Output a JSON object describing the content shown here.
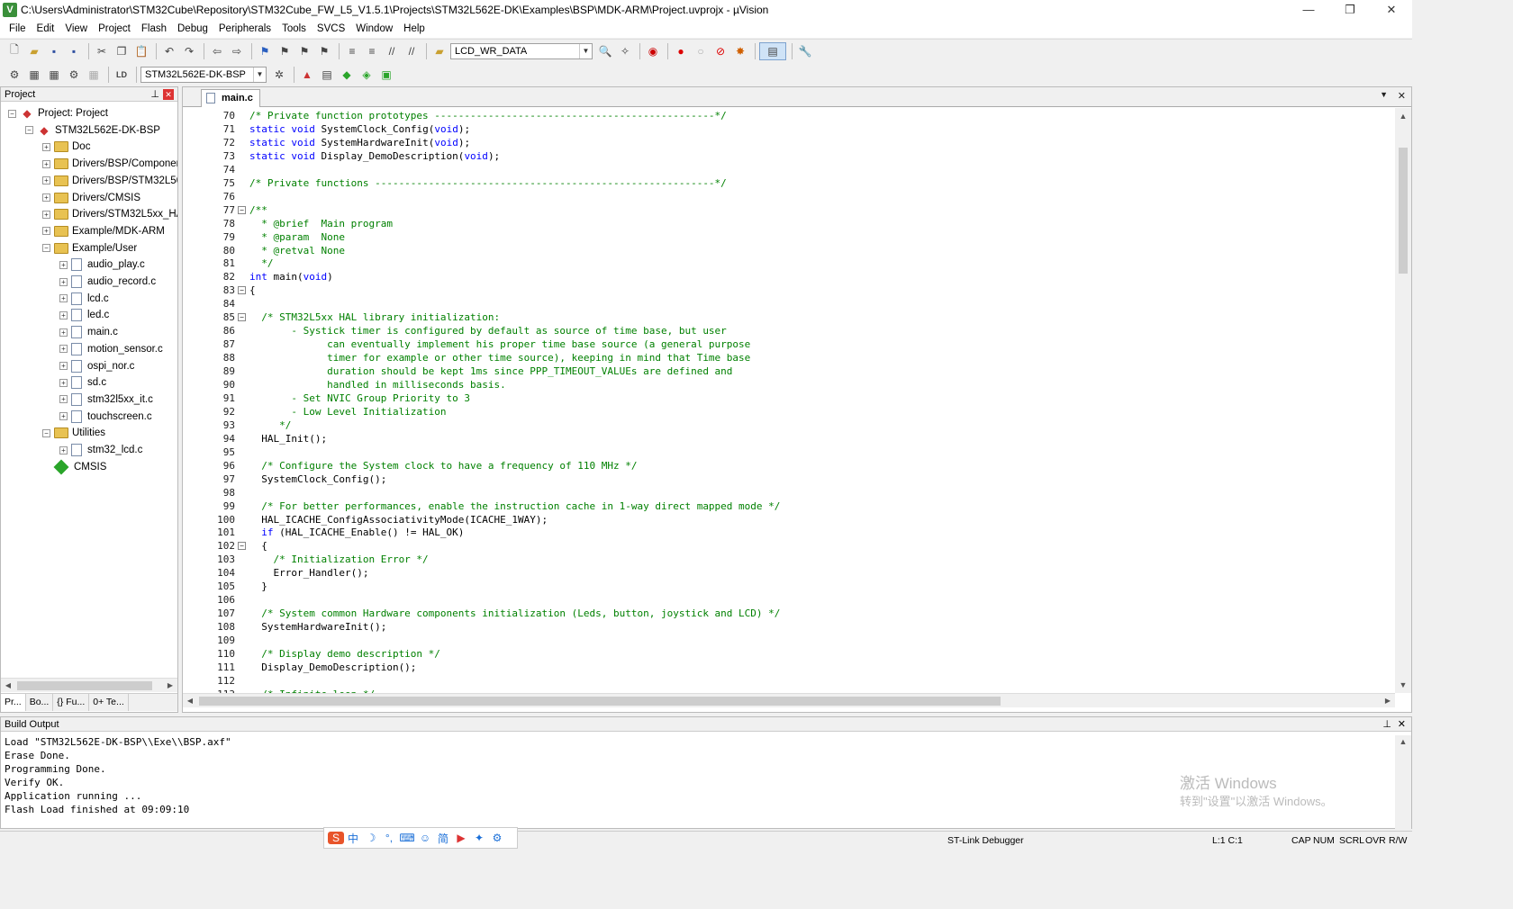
{
  "window": {
    "title": "C:\\Users\\Administrator\\STM32Cube\\Repository\\STM32Cube_FW_L5_V1.5.1\\Projects\\STM32L562E-DK\\Examples\\BSP\\MDK-ARM\\Project.uvprojx - µVision",
    "app_icon": "V"
  },
  "menu": [
    "File",
    "Edit",
    "View",
    "Project",
    "Flash",
    "Debug",
    "Peripherals",
    "Tools",
    "SVCS",
    "Window",
    "Help"
  ],
  "toolbar1": {
    "find_combo": "LCD_WR_DATA"
  },
  "toolbar2": {
    "target_combo": "STM32L562E-DK-BSP"
  },
  "project_panel": {
    "header": "Project",
    "tree": [
      {
        "label": "Project: Project",
        "level": 0,
        "kind": "project",
        "exp": "−"
      },
      {
        "label": "STM32L562E-DK-BSP",
        "level": 1,
        "kind": "target",
        "exp": "−"
      },
      {
        "label": "Doc",
        "level": 2,
        "kind": "folder",
        "exp": "+"
      },
      {
        "label": "Drivers/BSP/Componen",
        "level": 2,
        "kind": "folder",
        "exp": "+"
      },
      {
        "label": "Drivers/BSP/STM32L56",
        "level": 2,
        "kind": "folder",
        "exp": "+"
      },
      {
        "label": "Drivers/CMSIS",
        "level": 2,
        "kind": "folder",
        "exp": "+"
      },
      {
        "label": "Drivers/STM32L5xx_HA",
        "level": 2,
        "kind": "folder",
        "exp": "+"
      },
      {
        "label": "Example/MDK-ARM",
        "level": 2,
        "kind": "folder",
        "exp": "+"
      },
      {
        "label": "Example/User",
        "level": 2,
        "kind": "folder",
        "exp": "−"
      },
      {
        "label": "audio_play.c",
        "level": 3,
        "kind": "file",
        "exp": "+"
      },
      {
        "label": "audio_record.c",
        "level": 3,
        "kind": "file",
        "exp": "+"
      },
      {
        "label": "lcd.c",
        "level": 3,
        "kind": "file",
        "exp": "+"
      },
      {
        "label": "led.c",
        "level": 3,
        "kind": "file",
        "exp": "+"
      },
      {
        "label": "main.c",
        "level": 3,
        "kind": "file",
        "exp": "+"
      },
      {
        "label": "motion_sensor.c",
        "level": 3,
        "kind": "file",
        "exp": "+"
      },
      {
        "label": "ospi_nor.c",
        "level": 3,
        "kind": "file",
        "exp": "+"
      },
      {
        "label": "sd.c",
        "level": 3,
        "kind": "file",
        "exp": "+"
      },
      {
        "label": "stm32l5xx_it.c",
        "level": 3,
        "kind": "file",
        "exp": "+"
      },
      {
        "label": "touchscreen.c",
        "level": 3,
        "kind": "file",
        "exp": "+"
      },
      {
        "label": "Utilities",
        "level": 2,
        "kind": "folder",
        "exp": "−"
      },
      {
        "label": "stm32_lcd.c",
        "level": 3,
        "kind": "file",
        "exp": "+"
      },
      {
        "label": "CMSIS",
        "level": 2,
        "kind": "cmsis",
        "exp": ""
      }
    ],
    "tabs": [
      "Pr...",
      "Bo...",
      "{} Fu...",
      "0+ Te..."
    ]
  },
  "editor": {
    "tab": "main.c",
    "lines": [
      {
        "n": "70",
        "fold": "",
        "segs": [
          [
            "cm",
            "/* Private function prototypes -----------------------------------------------*/"
          ]
        ]
      },
      {
        "n": "71",
        "fold": "",
        "segs": [
          [
            "kw",
            "static void "
          ],
          [
            "",
            "SystemClock_Config("
          ],
          [
            "kw",
            "void"
          ],
          [
            "",
            ");"
          ]
        ]
      },
      {
        "n": "72",
        "fold": "",
        "segs": [
          [
            "kw",
            "static void "
          ],
          [
            "",
            "SystemHardwareInit("
          ],
          [
            "kw",
            "void"
          ],
          [
            "",
            ");"
          ]
        ]
      },
      {
        "n": "73",
        "fold": "",
        "segs": [
          [
            "kw",
            "static void "
          ],
          [
            "",
            "Display_DemoDescription("
          ],
          [
            "kw",
            "void"
          ],
          [
            "",
            ");"
          ]
        ]
      },
      {
        "n": "74",
        "fold": "",
        "segs": []
      },
      {
        "n": "75",
        "fold": "",
        "segs": [
          [
            "cm",
            "/* Private functions ---------------------------------------------------------*/"
          ]
        ]
      },
      {
        "n": "76",
        "fold": "",
        "segs": []
      },
      {
        "n": "77",
        "fold": "−",
        "segs": [
          [
            "cm",
            "/**"
          ]
        ]
      },
      {
        "n": "78",
        "fold": "",
        "segs": [
          [
            "cm",
            "  * @brief  Main program"
          ]
        ]
      },
      {
        "n": "79",
        "fold": "",
        "segs": [
          [
            "cm",
            "  * @param  None"
          ]
        ]
      },
      {
        "n": "80",
        "fold": "",
        "segs": [
          [
            "cm",
            "  * @retval None"
          ]
        ]
      },
      {
        "n": "81",
        "fold": "",
        "segs": [
          [
            "cm",
            "  */"
          ]
        ]
      },
      {
        "n": "82",
        "fold": "",
        "segs": [
          [
            "kw",
            "int "
          ],
          [
            "",
            "main("
          ],
          [
            "kw",
            "void"
          ],
          [
            "",
            ")"
          ]
        ]
      },
      {
        "n": "83",
        "fold": "−",
        "segs": [
          [
            "",
            "{"
          ]
        ]
      },
      {
        "n": "84",
        "fold": "",
        "segs": []
      },
      {
        "n": "85",
        "fold": "−",
        "segs": [
          [
            "cm",
            "  /* STM32L5xx HAL library initialization:"
          ]
        ]
      },
      {
        "n": "86",
        "fold": "",
        "segs": [
          [
            "cm",
            "       - Systick timer is configured by default as source of time base, but user"
          ]
        ]
      },
      {
        "n": "87",
        "fold": "",
        "segs": [
          [
            "cm",
            "             can eventually implement his proper time base source (a general purpose"
          ]
        ]
      },
      {
        "n": "88",
        "fold": "",
        "segs": [
          [
            "cm",
            "             timer for example or other time source), keeping in mind that Time base"
          ]
        ]
      },
      {
        "n": "89",
        "fold": "",
        "segs": [
          [
            "cm",
            "             duration should be kept 1ms since PPP_TIMEOUT_VALUEs are defined and"
          ]
        ]
      },
      {
        "n": "90",
        "fold": "",
        "segs": [
          [
            "cm",
            "             handled in milliseconds basis."
          ]
        ]
      },
      {
        "n": "91",
        "fold": "",
        "segs": [
          [
            "cm",
            "       - Set NVIC Group Priority to 3"
          ]
        ]
      },
      {
        "n": "92",
        "fold": "",
        "segs": [
          [
            "cm",
            "       - Low Level Initialization"
          ]
        ]
      },
      {
        "n": "93",
        "fold": "",
        "segs": [
          [
            "cm",
            "     */"
          ]
        ]
      },
      {
        "n": "94",
        "fold": "",
        "segs": [
          [
            "",
            "  HAL_Init();"
          ]
        ]
      },
      {
        "n": "95",
        "fold": "",
        "segs": []
      },
      {
        "n": "96",
        "fold": "",
        "segs": [
          [
            "cm",
            "  /* Configure the System clock to have a frequency of 110 MHz */"
          ]
        ]
      },
      {
        "n": "97",
        "fold": "",
        "segs": [
          [
            "",
            "  SystemClock_Config();"
          ]
        ]
      },
      {
        "n": "98",
        "fold": "",
        "segs": []
      },
      {
        "n": "99",
        "fold": "",
        "segs": [
          [
            "cm",
            "  /* For better performances, enable the instruction cache in 1-way direct mapped mode */"
          ]
        ]
      },
      {
        "n": "100",
        "fold": "",
        "segs": [
          [
            "",
            "  HAL_ICACHE_ConfigAssociativityMode(ICACHE_1WAY);"
          ]
        ]
      },
      {
        "n": "101",
        "fold": "",
        "segs": [
          [
            "kw",
            "  if "
          ],
          [
            "",
            "(HAL_ICACHE_Enable() != HAL_OK)"
          ]
        ]
      },
      {
        "n": "102",
        "fold": "−",
        "segs": [
          [
            "",
            "  {"
          ]
        ]
      },
      {
        "n": "103",
        "fold": "",
        "segs": [
          [
            "cm",
            "    /* Initialization Error */"
          ]
        ]
      },
      {
        "n": "104",
        "fold": "",
        "segs": [
          [
            "",
            "    Error_Handler();"
          ]
        ]
      },
      {
        "n": "105",
        "fold": "",
        "segs": [
          [
            "",
            "  }"
          ]
        ]
      },
      {
        "n": "106",
        "fold": "",
        "segs": []
      },
      {
        "n": "107",
        "fold": "",
        "segs": [
          [
            "cm",
            "  /* System common Hardware components initialization (Leds, button, joystick and LCD) */"
          ]
        ]
      },
      {
        "n": "108",
        "fold": "",
        "segs": [
          [
            "",
            "  SystemHardwareInit();"
          ]
        ]
      },
      {
        "n": "109",
        "fold": "",
        "segs": []
      },
      {
        "n": "110",
        "fold": "",
        "segs": [
          [
            "cm",
            "  /* Display demo description */"
          ]
        ]
      },
      {
        "n": "111",
        "fold": "",
        "segs": [
          [
            "",
            "  Display_DemoDescription();"
          ]
        ]
      },
      {
        "n": "112",
        "fold": "",
        "segs": []
      },
      {
        "n": "113",
        "fold": "",
        "segs": [
          [
            "cm",
            "  /* Infinite loop */"
          ]
        ]
      }
    ]
  },
  "build_output": {
    "header": "Build Output",
    "lines": [
      "Load \"STM32L562E-DK-BSP\\\\Exe\\\\BSP.axf\"",
      "Erase Done.",
      "Programming Done.",
      "Verify OK.",
      "Application running ...",
      "Flash Load finished at 09:09:10"
    ]
  },
  "watermark": {
    "line1": "激活 Windows",
    "line2": "转到\"设置\"以激活 Windows。"
  },
  "status": {
    "debugger": "ST-Link Debugger",
    "position": "L:1 C:1",
    "flags": [
      "CAP",
      "NUM",
      "SCRL",
      "OVR",
      "R/W"
    ]
  },
  "ime": {
    "items": [
      "中",
      "简"
    ]
  }
}
